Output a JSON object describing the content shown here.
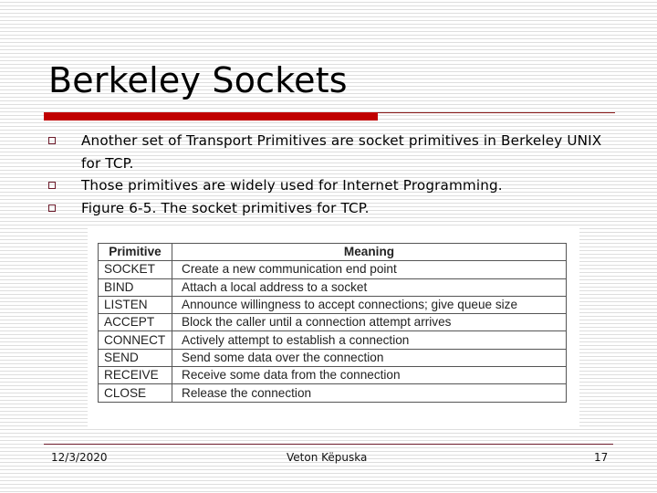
{
  "slide": {
    "title": "Berkeley Sockets",
    "accent_color": "#c00000",
    "bullet_color": "#6b1a2a",
    "bullets": [
      {
        "icon": "hollow-square-bullet",
        "text": "Another set of Transport Primitives are socket primitives in Berkeley UNIX for TCP."
      },
      {
        "icon": "hollow-square-bullet",
        "text": "Those primitives are widely used for Internet Programming."
      },
      {
        "icon": "hollow-square-bullet",
        "text": "Figure 6-5. The socket primitives for TCP."
      }
    ],
    "figure": {
      "columns": [
        "Primitive",
        "Meaning"
      ],
      "rows": [
        {
          "primitive": "SOCKET",
          "meaning": "Create a new communication end point"
        },
        {
          "primitive": "BIND",
          "meaning": "Attach a local address to a socket"
        },
        {
          "primitive": "LISTEN",
          "meaning": "Announce willingness to accept connections; give queue size"
        },
        {
          "primitive": "ACCEPT",
          "meaning": "Block the caller until a connection attempt arrives"
        },
        {
          "primitive": "CONNECT",
          "meaning": "Actively attempt to establish a connection"
        },
        {
          "primitive": "SEND",
          "meaning": "Send some data over the connection"
        },
        {
          "primitive": "RECEIVE",
          "meaning": "Receive some data from the connection"
        },
        {
          "primitive": "CLOSE",
          "meaning": "Release the connection"
        }
      ]
    },
    "footer": {
      "date": "12/3/2020",
      "author": "Veton Këpuska",
      "page_number": "17"
    }
  }
}
